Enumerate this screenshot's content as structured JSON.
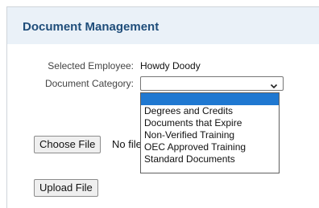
{
  "panel": {
    "title": "Document Management"
  },
  "form": {
    "employee_label": "Selected Employee:",
    "employee_value": "Howdy Doody",
    "category_label": "Document Category:",
    "category_selected": "",
    "category_options": [
      "",
      "Degrees and Credits",
      "Documents that Expire",
      "Non-Verified Training",
      "OEC Approved Training",
      "Standard Documents"
    ],
    "choose_file_label": "Choose File",
    "no_file_text": "No file chosen",
    "upload_label": "Upload File"
  },
  "icons": {
    "dropdown_arrow": "chevron-down-icon"
  },
  "colors": {
    "header_bg": "#eaf1f8",
    "title_text": "#1f4d7a",
    "highlight": "#1f78d1"
  }
}
